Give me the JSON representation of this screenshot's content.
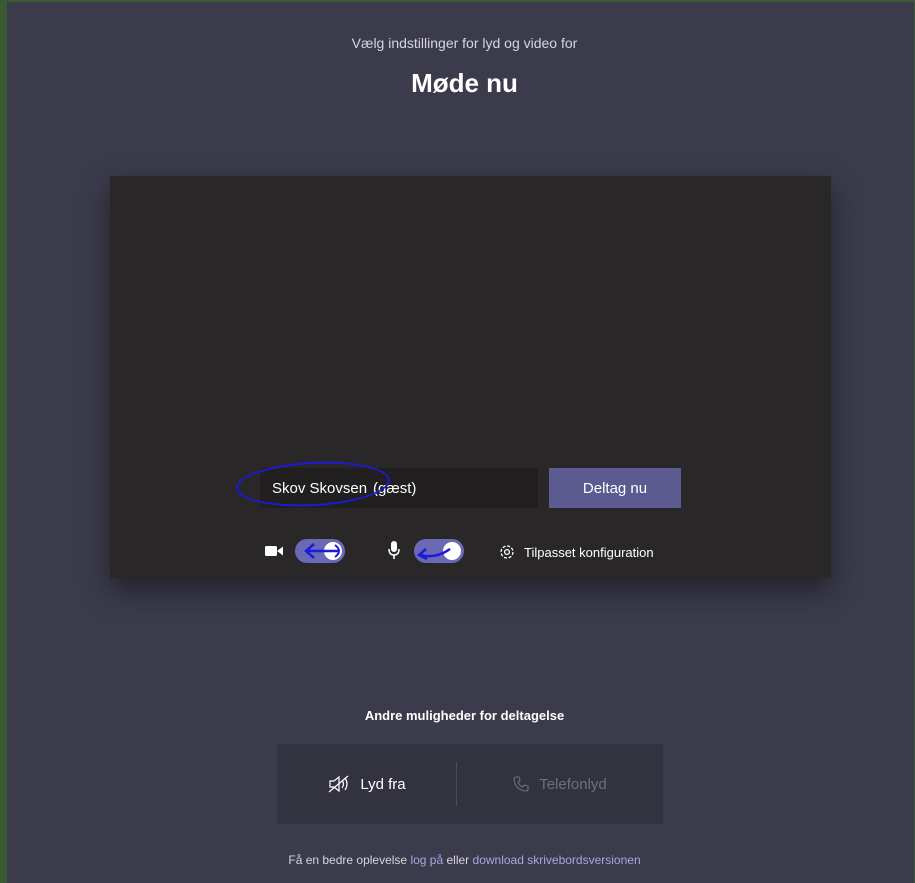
{
  "header": {
    "subtitle": "Vælg indstillinger for lyd og video for",
    "meeting_title": "Møde nu"
  },
  "join": {
    "name_value": "Skov Skovsen",
    "guest_suffix": "(gæst)",
    "join_button": "Deltag nu"
  },
  "controls": {
    "camera_on": true,
    "mic_on": true,
    "custom_config_label": "Tilpasset konfiguration",
    "icons": [
      "camera-icon",
      "microphone-icon",
      "gear-icon"
    ]
  },
  "other_options": {
    "title": "Andre muligheder for deltagelse",
    "audio_off_label": "Lyd fra",
    "phone_audio_label": "Telefonlyd"
  },
  "footer": {
    "prefix": "Få en bedre oplevelse",
    "login_link": "log på",
    "middle": "eller",
    "download_link": "download skrivebordsversionen"
  },
  "colors": {
    "background": "#3b3b4c",
    "preview": "#2a2728",
    "accent": "#5b5a91",
    "toggle_on": "#6a69b3",
    "annotation": "#1a1ad8"
  }
}
